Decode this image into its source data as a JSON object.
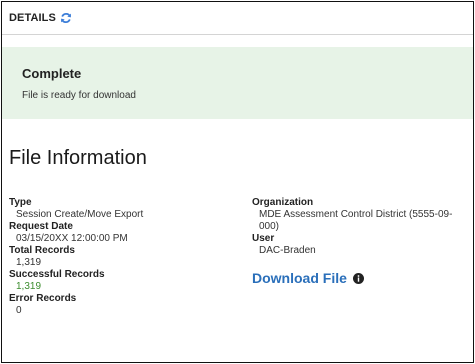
{
  "header": {
    "title": "DETAILS",
    "refresh_icon": "refresh-icon"
  },
  "status": {
    "title": "Complete",
    "message": "File is ready for download",
    "background": "#e7f3e7"
  },
  "section": {
    "title": "File Information"
  },
  "left": {
    "type_label": "Type",
    "type_value": "Session Create/Move Export",
    "request_date_label": "Request Date",
    "request_date_value": "03/15/20XX 12:00:00 PM",
    "total_records_label": "Total Records",
    "total_records_value": "1,319",
    "successful_records_label": "Successful Records",
    "successful_records_value": "1,319",
    "error_records_label": "Error Records",
    "error_records_value": "0"
  },
  "right": {
    "organization_label": "Organization",
    "organization_value_line1": "MDE Assessment Control District (5555-09-",
    "organization_value_line2": "000)",
    "user_label": "User",
    "user_value": "DAC-Braden",
    "download_label": "Download File",
    "info_icon": "info-icon"
  },
  "colors": {
    "success_green": "#3c8d2f",
    "link_blue": "#2a6fba",
    "refresh_blue": "#3b7dd8"
  }
}
